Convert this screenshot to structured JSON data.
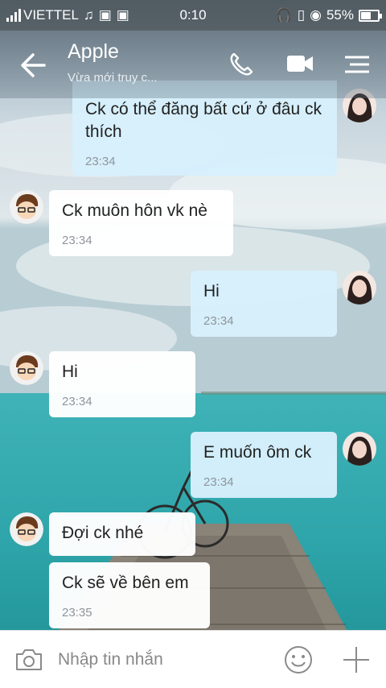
{
  "status_bar": {
    "carrier": "VIETTEL",
    "time": "0:10",
    "battery": "55%",
    "icons": [
      "signal-icon",
      "music-icon",
      "image-icon",
      "image-icon",
      "headset-icon",
      "phone-icon",
      "eye-icon",
      "battery-icon"
    ]
  },
  "header": {
    "title": "Apple",
    "subtitle": "Vừa mới truy c...",
    "icons": [
      "back-arrow-icon",
      "phone-call-icon",
      "video-call-icon",
      "menu-icon"
    ]
  },
  "messages": [
    {
      "side": "sent",
      "text": "Ck có thể đăng bất cứ ở đâu ck thích",
      "time": "23:34"
    },
    {
      "side": "recv",
      "text": "Ck muôn hôn vk nè",
      "time": "23:34"
    },
    {
      "side": "sent",
      "text": "Hi",
      "time": "23:34"
    },
    {
      "side": "recv",
      "text": "Hi",
      "time": "23:34"
    },
    {
      "side": "sent",
      "text": "E muốn ôm ck",
      "time": "23:34"
    },
    {
      "side": "recv",
      "text": "Đợi ck nhé",
      "time": ""
    },
    {
      "side": "recv",
      "text": "Ck sẽ về bên em",
      "time": "23:35"
    }
  ],
  "input": {
    "placeholder": "Nhập tin nhắn",
    "icons": [
      "camera-icon",
      "emoji-icon",
      "plus-icon"
    ]
  },
  "colors": {
    "sent_bubble": "#d7effc",
    "recv_bubble": "#ffffff",
    "time_text": "#8f959a"
  }
}
